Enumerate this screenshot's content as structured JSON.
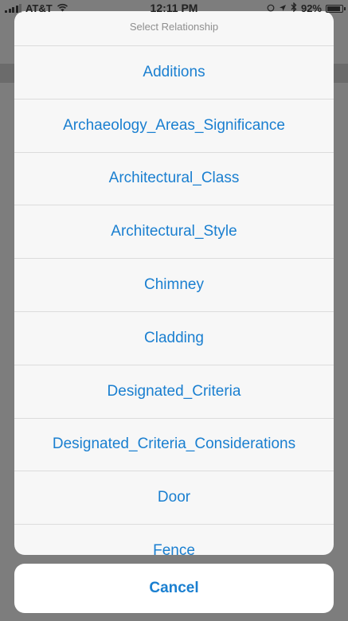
{
  "status_bar": {
    "carrier": "AT&T",
    "time": "12:11 PM",
    "battery": "92%",
    "battery_level": 0.92
  },
  "sheet": {
    "title": "Select Relationship",
    "items": [
      {
        "label": "Additions"
      },
      {
        "label": "Archaeology_Areas_Significance"
      },
      {
        "label": "Architectural_Class"
      },
      {
        "label": "Architectural_Style"
      },
      {
        "label": "Chimney"
      },
      {
        "label": "Cladding"
      },
      {
        "label": "Designated_Criteria"
      },
      {
        "label": "Designated_Criteria_Considerations"
      },
      {
        "label": "Door"
      },
      {
        "label": "Fence"
      }
    ]
  },
  "cancel": {
    "label": "Cancel"
  }
}
